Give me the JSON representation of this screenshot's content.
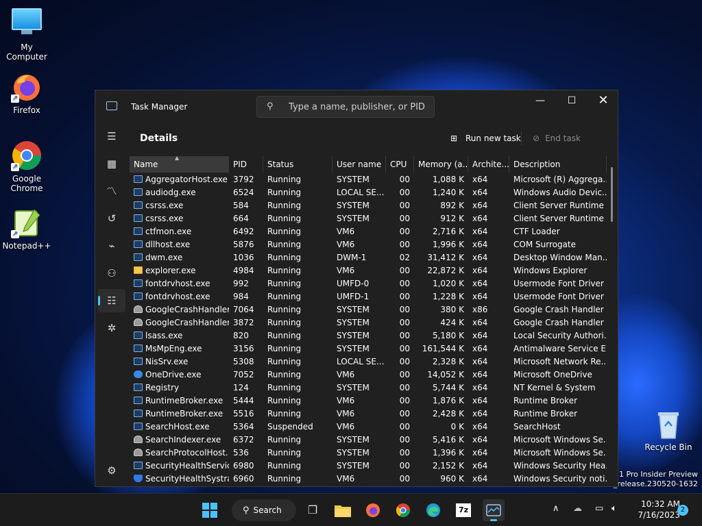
{
  "desktop": {
    "icons": [
      {
        "label": "My Computer"
      },
      {
        "label": "Firefox"
      },
      {
        "label": "Google Chrome"
      },
      {
        "label": "Notepad++"
      },
      {
        "label": "Recycle Bin"
      }
    ],
    "watermark": {
      "line1": "11 Pro Insider Preview",
      "line2": "n_release.230520-1632"
    }
  },
  "window": {
    "title": "Task Manager",
    "search_placeholder": "Type a name, publisher, or PID...",
    "page_title": "Details",
    "run_new_task": "Run new task",
    "end_task": "End task",
    "columns": [
      "Name",
      "PID",
      "Status",
      "User name",
      "CPU",
      "Memory (a...",
      "Archite...",
      "Description"
    ],
    "rows": [
      {
        "name": "AggregatorHost.exe",
        "pid": "3792",
        "status": "Running",
        "user": "SYSTEM",
        "cpu": "00",
        "mem": "1,088 K",
        "arch": "x64",
        "desc": "Microsoft (R) Aggrega...",
        "icon": "app"
      },
      {
        "name": "audiodg.exe",
        "pid": "6524",
        "status": "Running",
        "user": "LOCAL SE...",
        "cpu": "00",
        "mem": "1,240 K",
        "arch": "x64",
        "desc": "Windows Audio Devic...",
        "icon": "app"
      },
      {
        "name": "csrss.exe",
        "pid": "584",
        "status": "Running",
        "user": "SYSTEM",
        "cpu": "00",
        "mem": "892 K",
        "arch": "x64",
        "desc": "Client Server Runtime ...",
        "icon": "app"
      },
      {
        "name": "csrss.exe",
        "pid": "664",
        "status": "Running",
        "user": "SYSTEM",
        "cpu": "00",
        "mem": "912 K",
        "arch": "x64",
        "desc": "Client Server Runtime ...",
        "icon": "app"
      },
      {
        "name": "ctfmon.exe",
        "pid": "6492",
        "status": "Running",
        "user": "VM6",
        "cpu": "00",
        "mem": "2,716 K",
        "arch": "x64",
        "desc": "CTF Loader",
        "icon": "app"
      },
      {
        "name": "dllhost.exe",
        "pid": "5876",
        "status": "Running",
        "user": "VM6",
        "cpu": "00",
        "mem": "1,996 K",
        "arch": "x64",
        "desc": "COM Surrogate",
        "icon": "app"
      },
      {
        "name": "dwm.exe",
        "pid": "1036",
        "status": "Running",
        "user": "DWM-1",
        "cpu": "02",
        "mem": "31,412 K",
        "arch": "x64",
        "desc": "Desktop Window Man...",
        "icon": "app"
      },
      {
        "name": "explorer.exe",
        "pid": "4984",
        "status": "Running",
        "user": "VM6",
        "cpu": "00",
        "mem": "22,872 K",
        "arch": "x64",
        "desc": "Windows Explorer",
        "icon": "folder"
      },
      {
        "name": "fontdrvhost.exe",
        "pid": "992",
        "status": "Running",
        "user": "UMFD-0",
        "cpu": "00",
        "mem": "1,020 K",
        "arch": "x64",
        "desc": "Usermode Font Driver ...",
        "icon": "app"
      },
      {
        "name": "fontdrvhost.exe",
        "pid": "984",
        "status": "Running",
        "user": "UMFD-1",
        "cpu": "00",
        "mem": "1,228 K",
        "arch": "x64",
        "desc": "Usermode Font Driver ...",
        "icon": "app"
      },
      {
        "name": "GoogleCrashHandler...",
        "pid": "7064",
        "status": "Running",
        "user": "SYSTEM",
        "cpu": "00",
        "mem": "380 K",
        "arch": "x86",
        "desc": "Google Crash Handler",
        "icon": "user"
      },
      {
        "name": "GoogleCrashHandler...",
        "pid": "3872",
        "status": "Running",
        "user": "SYSTEM",
        "cpu": "00",
        "mem": "424 K",
        "arch": "x64",
        "desc": "Google Crash Handler",
        "icon": "user"
      },
      {
        "name": "lsass.exe",
        "pid": "820",
        "status": "Running",
        "user": "SYSTEM",
        "cpu": "00",
        "mem": "5,180 K",
        "arch": "x64",
        "desc": "Local Security Authori...",
        "icon": "app"
      },
      {
        "name": "MsMpEng.exe",
        "pid": "3156",
        "status": "Running",
        "user": "SYSTEM",
        "cpu": "00",
        "mem": "161,544 K",
        "arch": "x64",
        "desc": "Antimalware Service E...",
        "icon": "app"
      },
      {
        "name": "NisSrv.exe",
        "pid": "5308",
        "status": "Running",
        "user": "LOCAL SE...",
        "cpu": "00",
        "mem": "2,328 K",
        "arch": "x64",
        "desc": "Microsoft Network Re...",
        "icon": "app"
      },
      {
        "name": "OneDrive.exe",
        "pid": "7052",
        "status": "Running",
        "user": "VM6",
        "cpu": "00",
        "mem": "14,052 K",
        "arch": "x64",
        "desc": "Microsoft OneDrive",
        "icon": "cloud"
      },
      {
        "name": "Registry",
        "pid": "124",
        "status": "Running",
        "user": "SYSTEM",
        "cpu": "00",
        "mem": "5,744 K",
        "arch": "x64",
        "desc": "NT Kernel & System",
        "icon": "app"
      },
      {
        "name": "RuntimeBroker.exe",
        "pid": "5444",
        "status": "Running",
        "user": "VM6",
        "cpu": "00",
        "mem": "1,876 K",
        "arch": "x64",
        "desc": "Runtime Broker",
        "icon": "app"
      },
      {
        "name": "RuntimeBroker.exe",
        "pid": "5516",
        "status": "Running",
        "user": "VM6",
        "cpu": "00",
        "mem": "2,428 K",
        "arch": "x64",
        "desc": "Runtime Broker",
        "icon": "app"
      },
      {
        "name": "SearchHost.exe",
        "pid": "5364",
        "status": "Suspended",
        "user": "VM6",
        "cpu": "00",
        "mem": "0 K",
        "arch": "x64",
        "desc": "SearchHost",
        "icon": "app"
      },
      {
        "name": "SearchIndexer.exe",
        "pid": "6372",
        "status": "Running",
        "user": "SYSTEM",
        "cpu": "00",
        "mem": "5,416 K",
        "arch": "x64",
        "desc": "Microsoft Windows Se...",
        "icon": "user"
      },
      {
        "name": "SearchProtocolHost....",
        "pid": "536",
        "status": "Running",
        "user": "SYSTEM",
        "cpu": "00",
        "mem": "1,396 K",
        "arch": "x64",
        "desc": "Microsoft Windows Se...",
        "icon": "user"
      },
      {
        "name": "SecurityHealthServic...",
        "pid": "6980",
        "status": "Running",
        "user": "SYSTEM",
        "cpu": "00",
        "mem": "2,152 K",
        "arch": "x64",
        "desc": "Windows Security Hea...",
        "icon": "app"
      },
      {
        "name": "SecurityHealthSystra...",
        "pid": "6960",
        "status": "Running",
        "user": "VM6",
        "cpu": "00",
        "mem": "960 K",
        "arch": "x64",
        "desc": "Windows Security noti...",
        "icon": "shield"
      }
    ]
  },
  "taskbar": {
    "search_label": "Search",
    "time": "10:32 AM",
    "date": "7/16/2023",
    "notification_count": "2",
    "accent": "#4cc2ff"
  }
}
